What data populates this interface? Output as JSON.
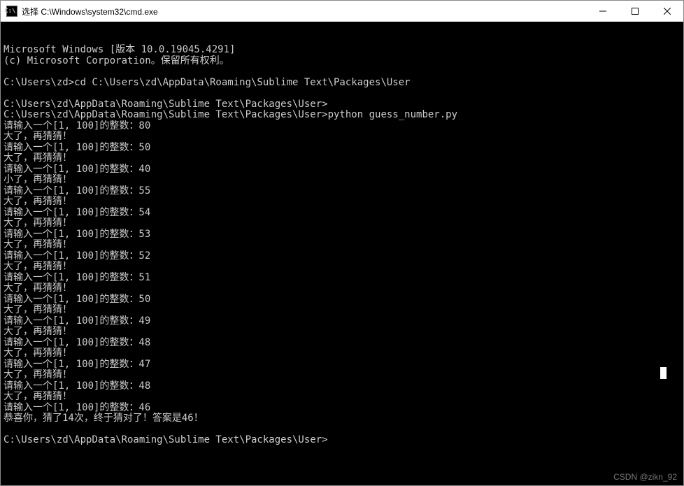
{
  "window": {
    "icon_text": "C:\\.",
    "title": "选择 C:\\Windows\\system32\\cmd.exe"
  },
  "terminal": {
    "lines": [
      "Microsoft Windows [版本 10.0.19045.4291]",
      "(c) Microsoft Corporation。保留所有权利。",
      "",
      "C:\\Users\\zd>cd C:\\Users\\zd\\AppData\\Roaming\\Sublime Text\\Packages\\User",
      "",
      "C:\\Users\\zd\\AppData\\Roaming\\Sublime Text\\Packages\\User>",
      "C:\\Users\\zd\\AppData\\Roaming\\Sublime Text\\Packages\\User>python guess_number.py",
      "请输入一个[1, 100]的整数：80",
      "大了，再猜猜！",
      "请输入一个[1, 100]的整数：50",
      "大了，再猜猜！",
      "请输入一个[1, 100]的整数：40",
      "小了，再猜猜！",
      "请输入一个[1, 100]的整数：55",
      "大了，再猜猜！",
      "请输入一个[1, 100]的整数：54",
      "大了，再猜猜！",
      "请输入一个[1, 100]的整数：53",
      "大了，再猜猜！",
      "请输入一个[1, 100]的整数：52",
      "大了，再猜猜！",
      "请输入一个[1, 100]的整数：51",
      "大了，再猜猜！",
      "请输入一个[1, 100]的整数：50",
      "大了，再猜猜！",
      "请输入一个[1, 100]的整数：49",
      "大了，再猜猜！",
      "请输入一个[1, 100]的整数：48",
      "大了，再猜猜！",
      "请输入一个[1, 100]的整数：47",
      "大了，再猜猜！",
      "请输入一个[1, 100]的整数：48",
      "大了，再猜猜！",
      "请输入一个[1, 100]的整数：46",
      "恭喜你，猜了14次，终于猜对了！答案是46！",
      "",
      "C:\\Users\\zd\\AppData\\Roaming\\Sublime Text\\Packages\\User>"
    ]
  },
  "watermark": "CSDN @zikn_92"
}
